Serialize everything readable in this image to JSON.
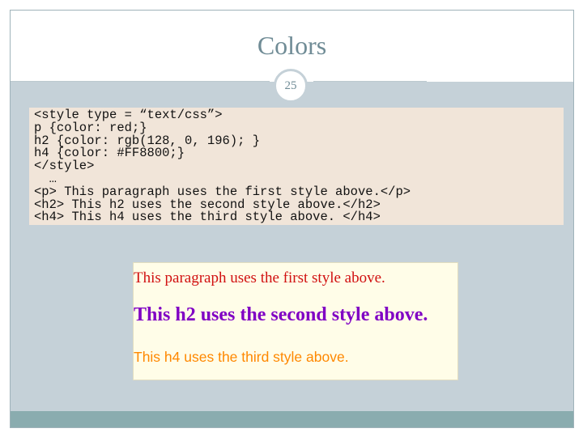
{
  "slide": {
    "title": "Colors",
    "page_number": "25"
  },
  "code": {
    "lines": [
      "<style type = “text/css”>",
      "p {color: red;}",
      "h2 {color: rgb(128, 0, 196); }",
      "h4 {color: #FF8800;}",
      "</style>",
      "  …",
      "<p> This paragraph uses the first style above.</p>",
      "<h2> This h2 uses the second style above.</h2>",
      "<h4> This h4 uses the third style above. </h4>"
    ]
  },
  "demo": {
    "p_text": "This paragraph uses the first style above.",
    "h2_text": "This h2 uses the second style above.",
    "h4_text": "This h4 uses the third style above."
  },
  "colors": {
    "p": "#d11111",
    "h2": "#8000c4",
    "h4": "#ff8800",
    "slide_background": "#c5d1d8",
    "code_background": "#f1e5d9",
    "demo_background": "#fffde8"
  }
}
